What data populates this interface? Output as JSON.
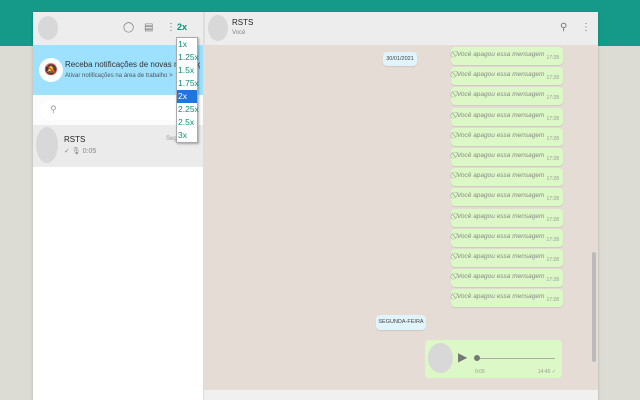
{
  "sidebar": {
    "speed_label": "2x",
    "notification": {
      "title": "Receba notificações de novas mensagens",
      "link": "Ativar notificações na área de trabalho >"
    },
    "search": {
      "placeholder": ""
    },
    "chats": [
      {
        "name": "RSTS",
        "last": "✓ 🎙 0:05",
        "time": "Segu"
      }
    ]
  },
  "speed_menu": {
    "options": [
      "1x",
      "1.25x",
      "1.5x",
      "1.75x",
      "2x",
      "2.25x",
      "2.5x",
      "3x"
    ],
    "selected": "2x"
  },
  "chat": {
    "name": "RSTS",
    "subtitle": "Você",
    "date_chip": "30/01/2021",
    "day_chip": "SEGUNDA-FEIRA",
    "messages": [
      {
        "text": "Você apagou essa mensagem",
        "time": "17:28"
      },
      {
        "text": "Você apagou essa mensagem",
        "time": "17:28"
      },
      {
        "text": "Você apagou essa mensagem",
        "time": "17:28"
      },
      {
        "text": "Você apagou essa mensagem",
        "time": "17:28"
      },
      {
        "text": "Você apagou essa mensagem",
        "time": "17:28"
      },
      {
        "text": "Você apagou essa mensagem",
        "time": "17:28"
      },
      {
        "text": "Você apagou essa mensagem",
        "time": "17:28"
      },
      {
        "text": "Você apagou essa mensagem",
        "time": "17:28"
      },
      {
        "text": "Você apagou essa mensagem",
        "time": "17:28"
      },
      {
        "text": "Você apagou essa mensagem",
        "time": "17:28"
      },
      {
        "text": "Você apagou essa mensagem",
        "time": "17:28"
      },
      {
        "text": "Você apagou essa mensagem",
        "time": "17:28"
      },
      {
        "text": "Você apagou essa mensagem",
        "time": "17:28"
      }
    ],
    "audio": {
      "duration": "0:05",
      "time": "14:45 ✓",
      "progress": 0
    }
  }
}
